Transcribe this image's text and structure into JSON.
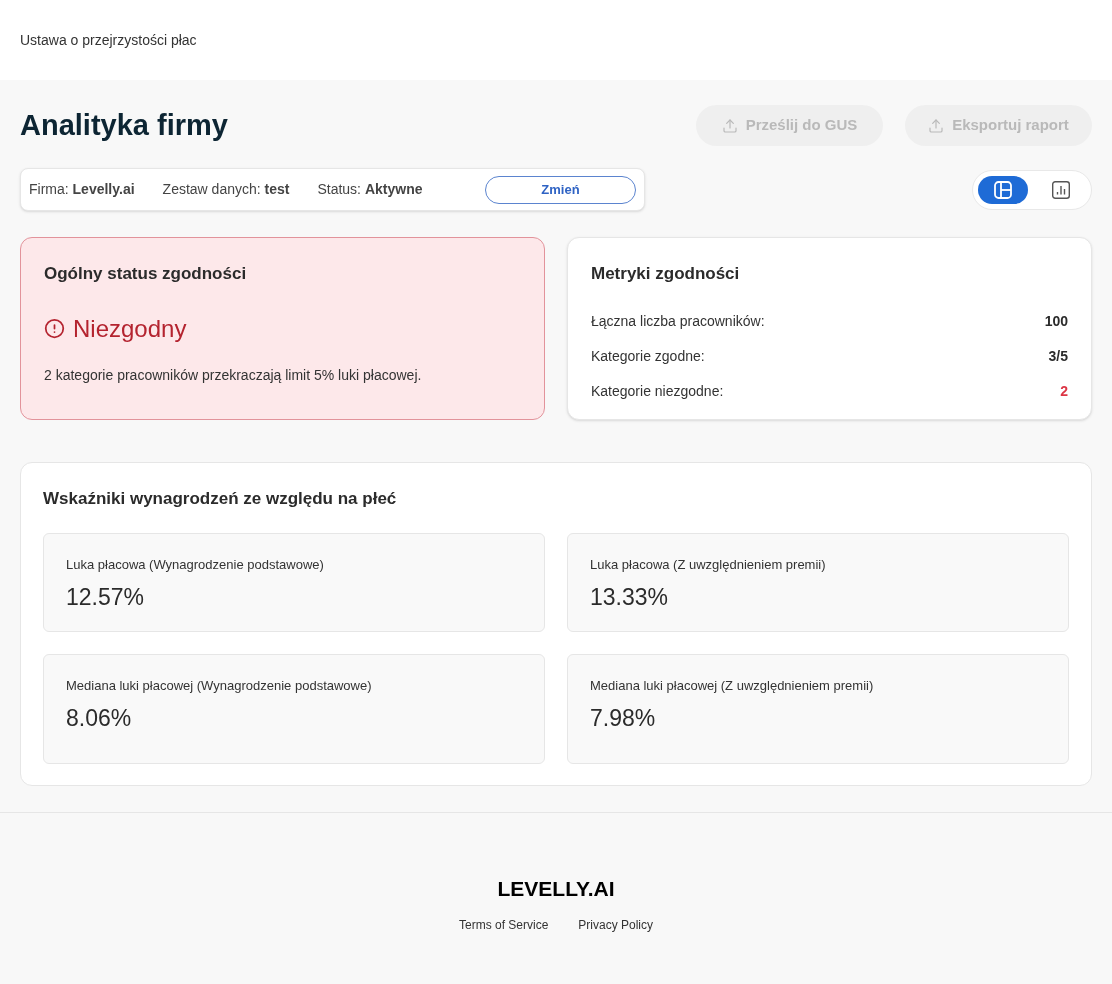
{
  "header": {
    "title": "Ustawa o przejrzystości płac"
  },
  "page": {
    "title": "Analityka firmy",
    "actions": [
      {
        "label": "Prześlij do GUS",
        "disabled": true
      },
      {
        "label": "Eksportuj raport",
        "disabled": true
      }
    ]
  },
  "info_bar": {
    "items": [
      "Firma: **Levelly.ai**",
      "Zestaw danych: **test**",
      "Status: **Aktywne**"
    ],
    "button": "Zmień"
  },
  "view_toggle": [
    {
      "kind": "layout",
      "selected": true
    },
    {
      "kind": "chart",
      "selected": false
    }
  ],
  "overall_status": {
    "title": "Ogólny status zgodności",
    "kind": "noncompliant",
    "label": "Niezgodny",
    "description": "2 kategorie pracowników przekraczają limit 5% luki płacowej."
  },
  "metrics": {
    "title": "Metryki zgodności",
    "rows": [
      {
        "label": "Łączna liczba pracowników:",
        "value": "100",
        "color": "#2b2b2b"
      },
      {
        "label": "Kategorie zgodne:",
        "value": "3/5",
        "color": "#2b2b2b"
      },
      {
        "label": "Kategorie niezgodne:",
        "value": "2",
        "color": "#dc3545"
      }
    ]
  },
  "gender_indicators": {
    "title": "Wskaźniki wynagrodzeń ze względu na płeć",
    "cards": [
      {
        "label": "Luka płacowa (Wynagrodzenie podstawowe)",
        "value": "12.57%"
      },
      {
        "label": "Luka płacowa (Z uwzględnieniem premii)",
        "value": "13.33%"
      },
      {
        "label": "Mediana luki płacowej (Wynagrodzenie podstawowe)",
        "value": "8.06%"
      },
      {
        "label": "Mediana luki płacowej (Z uwzględnieniem premii)",
        "value": "7.98%"
      }
    ]
  },
  "footer": {
    "brand": "LEVELLY.AI",
    "links": [
      "Terms of Service",
      "Privacy Policy"
    ]
  }
}
